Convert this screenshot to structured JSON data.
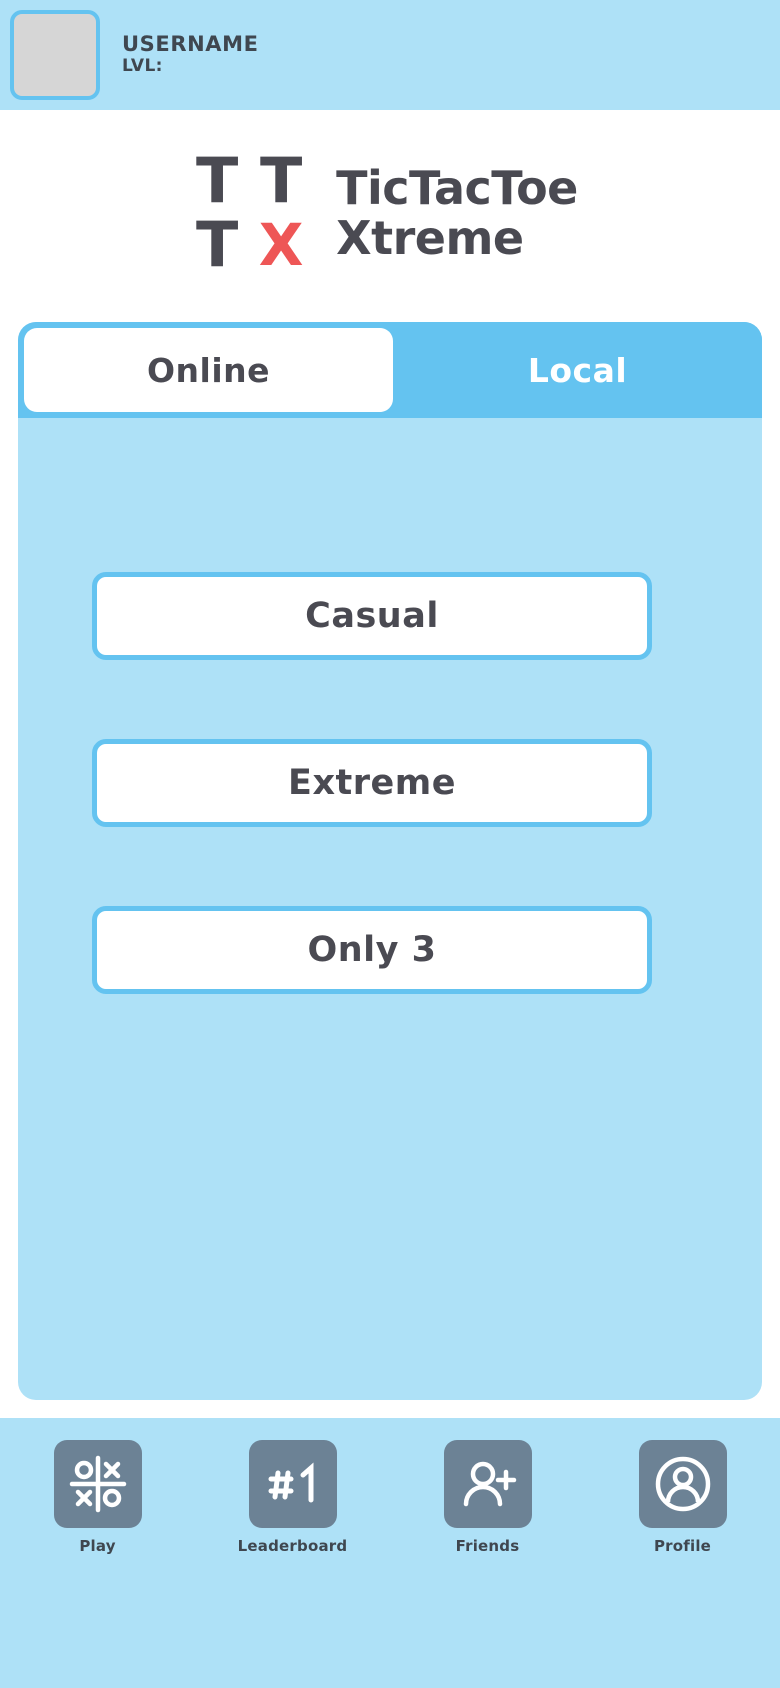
{
  "header": {
    "avatar_label": "avatar-placeholder",
    "username": "USERNAME",
    "level": "LVL:"
  },
  "logo": {
    "mark": [
      "T",
      "T",
      "T",
      "X"
    ],
    "line1": "TicTacToe",
    "line2": "Xtreme"
  },
  "tabs": [
    {
      "label": "Online",
      "active": false
    },
    {
      "label": "Local",
      "active": true
    }
  ],
  "modes": [
    {
      "label": "Casual"
    },
    {
      "label": "Extreme"
    },
    {
      "label": "Only 3"
    }
  ],
  "bottom_nav": [
    {
      "label": "Play",
      "icon": "tictactoe-grid-icon"
    },
    {
      "label": "Leaderboard",
      "icon": "rank-number-one-icon"
    },
    {
      "label": "Friends",
      "icon": "person-add-icon"
    },
    {
      "label": "Profile",
      "icon": "account-circle-icon"
    }
  ],
  "colors": {
    "panel_blue": "#AEE1F7",
    "accent_blue": "#64C3F0",
    "text_dark": "#4A4A52",
    "logo_red": "#EE5656",
    "nav_tile": "#6C8295",
    "avatar_gray": "#D6D6D6"
  }
}
